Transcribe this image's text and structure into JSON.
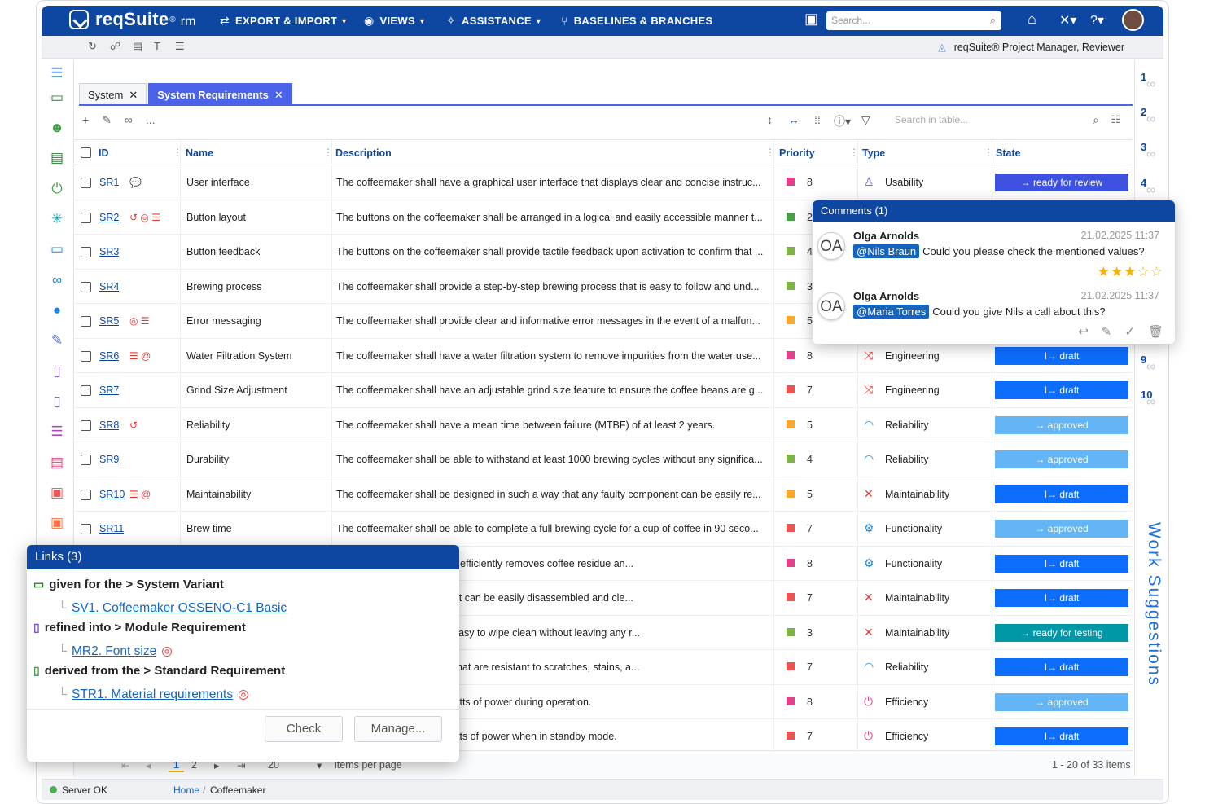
{
  "app": {
    "brand": "reqSuite",
    "brand_sup": "®",
    "brand_suffix": "rm",
    "nav": [
      {
        "label": "EXPORT & IMPORT",
        "icon": "export-import-icon"
      },
      {
        "label": "VIEWS",
        "icon": "eye-icon"
      },
      {
        "label": "ASSISTANCE",
        "icon": "magic-wand-icon"
      },
      {
        "label": "BASELINES & BRANCHES",
        "icon": "branch-icon"
      }
    ],
    "search_placeholder": "Search...",
    "role": "reqSuite® Project Manager, Reviewer"
  },
  "tabs": [
    {
      "label": "System",
      "active": false
    },
    {
      "label": "System Requirements",
      "active": true
    }
  ],
  "table": {
    "toolbar_more": "...",
    "search_placeholder": "Search in table...",
    "columns": [
      "ID",
      "Name",
      "Description",
      "Priority",
      "Type",
      "State"
    ],
    "rows": [
      {
        "id": "SR1",
        "icons": "💬",
        "name": "User interface",
        "desc": "The coffeemaker shall have a graphical user interface that displays clear and concise instruc...",
        "pcolor": "#e83e8c",
        "priority": "8",
        "ticon": "usability-icon",
        "tglyph": "♙",
        "tcolor": "#6a5acd",
        "type": "Usability",
        "state": "→ ready for review",
        "scolor": "#3f51e0"
      },
      {
        "id": "SR2",
        "icons": "↺ ◎ ☰",
        "name": "Button layout",
        "desc": "The buttons on the coffeemaker shall be arranged in a logical and easily accessible manner t...",
        "pcolor": "#43a047",
        "priority": "2",
        "ticon": "",
        "tglyph": "",
        "tcolor": "",
        "type": "",
        "state": "",
        "scolor": ""
      },
      {
        "id": "SR3",
        "icons": "",
        "name": "Button feedback",
        "desc": "The buttons on the coffeemaker shall provide tactile feedback upon activation to confirm that ...",
        "pcolor": "#7cb342",
        "priority": "4",
        "ticon": "",
        "tglyph": "",
        "tcolor": "",
        "type": "",
        "state": "",
        "scolor": ""
      },
      {
        "id": "SR4",
        "icons": "",
        "name": "Brewing process",
        "desc": "The coffeemaker shall provide a step-by-step brewing process that is easy to follow and und...",
        "pcolor": "#7cb342",
        "priority": "3",
        "ticon": "",
        "tglyph": "",
        "tcolor": "",
        "type": "",
        "state": "",
        "scolor": ""
      },
      {
        "id": "SR5",
        "icons": "◎ ☰",
        "name": "Error messaging",
        "desc": "The coffeemaker shall provide clear and informative error messages in the event of a malfun...",
        "pcolor": "#ffa726",
        "priority": "5",
        "ticon": "",
        "tglyph": "",
        "tcolor": "",
        "type": "",
        "state": "",
        "scolor": ""
      },
      {
        "id": "SR6",
        "icons": "☰ @",
        "name": "Water Filtration System",
        "desc": "The coffeemaker shall have a water filtration system to remove impurities from the water use...",
        "pcolor": "#e83e8c",
        "priority": "8",
        "ticon": "shuffle-icon",
        "tglyph": "⤨",
        "tcolor": "#e53935",
        "type": "Engineering",
        "state": "I→ draft",
        "scolor": "#0d6efd"
      },
      {
        "id": "SR7",
        "icons": "",
        "name": "Grind Size Adjustment",
        "desc": "The coffeemaker shall have an adjustable grind size feature to ensure the coffee beans are g...",
        "pcolor": "#ef5350",
        "priority": "7",
        "ticon": "shuffle-icon",
        "tglyph": "⤨",
        "tcolor": "#e53935",
        "type": "Engineering",
        "state": "I→ draft",
        "scolor": "#0d6efd"
      },
      {
        "id": "SR8",
        "icons": "↺",
        "name": "Reliability",
        "desc": "The coffeemaker shall have a mean time between failure (MTBF) of at least 2 years.",
        "pcolor": "#ffa726",
        "priority": "5",
        "ticon": "wifi-icon",
        "tglyph": "◠",
        "tcolor": "#1e88e5",
        "type": "Reliability",
        "state": "→ approved",
        "scolor": "#64b5f6"
      },
      {
        "id": "SR9",
        "icons": "",
        "name": "Durability",
        "desc": "The coffeemaker shall be able to withstand at least 1000 brewing cycles without any significa...",
        "pcolor": "#7cb342",
        "priority": "4",
        "ticon": "wifi-icon",
        "tglyph": "◠",
        "tcolor": "#1e88e5",
        "type": "Reliability",
        "state": "→ approved",
        "scolor": "#64b5f6"
      },
      {
        "id": "SR10",
        "icons": "☰ @",
        "name": "Maintainability",
        "desc": "The coffeemaker shall be designed in such a way that any faulty component can be easily re...",
        "pcolor": "#ffa726",
        "priority": "5",
        "ticon": "tools-icon",
        "tglyph": "✕",
        "tcolor": "#e53935",
        "type": "Maintainability",
        "state": "I→ draft",
        "scolor": "#0d6efd"
      },
      {
        "id": "SR11",
        "icons": "",
        "name": "Brew time",
        "desc": "The coffeemaker shall be able to complete a full brewing cycle for a cup of coffee in 90 seco...",
        "pcolor": "#ef5350",
        "priority": "7",
        "ticon": "gears-icon",
        "tglyph": "⚙",
        "tcolor": "#1e88e5",
        "type": "Functionality",
        "state": "→ approved",
        "scolor": "#64b5f6"
      },
      {
        "id": "",
        "icons": "",
        "name": "",
        "desc": "a cleaning mechanism that efficiently removes coffee residue an...",
        "pcolor": "#e83e8c",
        "priority": "8",
        "ticon": "gears-icon",
        "tglyph": "⚙",
        "tcolor": "#1e88e5",
        "type": "Functionality",
        "state": "I→ draft",
        "scolor": "#0d6efd"
      },
      {
        "id": "",
        "icons": "",
        "name": "",
        "desc": "removable components that can be easily disassembled and cle...",
        "pcolor": "#ef5350",
        "priority": "7",
        "ticon": "tools-icon",
        "tglyph": "✕",
        "tcolor": "#e53935",
        "type": "Maintainability",
        "state": "I→ draft",
        "scolor": "#0d6efd"
      },
      {
        "id": "",
        "icons": "",
        "name": "",
        "desc": "aker shall be smooth and easy to wipe clean without leaving any r...",
        "pcolor": "#7cb342",
        "priority": "3",
        "ticon": "tools-icon",
        "tglyph": "✕",
        "tcolor": "#e53935",
        "type": "Maintainability",
        "state": "→ ready for testing",
        "scolor": "#0097a7"
      },
      {
        "id": "",
        "icons": "",
        "name": "",
        "desc": "nade of durable materials that are resistant to scratches, stains, a...",
        "pcolor": "#ef5350",
        "priority": "7",
        "ticon": "wifi-icon",
        "tglyph": "◠",
        "tcolor": "#1e88e5",
        "type": "Reliability",
        "state": "I→ draft",
        "scolor": "#0d6efd"
      },
      {
        "id": "",
        "icons": "",
        "name": "",
        "desc": "sume no more than 500 watts of power during operation.",
        "pcolor": "#e83e8c",
        "priority": "8",
        "ticon": "power-icon",
        "tglyph": "⏻",
        "tcolor": "#e83e8c",
        "type": "Efficiency",
        "state": "→ approved",
        "scolor": "#64b5f6"
      },
      {
        "id": "",
        "icons": "",
        "name": "",
        "desc": "sume no more than 0.5 watts of power when in standby mode.",
        "pcolor": "#ef5350",
        "priority": "7",
        "ticon": "power-icon",
        "tglyph": "⏻",
        "tcolor": "#e83e8c",
        "type": "Efficiency",
        "state": "I→ draft",
        "scolor": "#0d6efd"
      }
    ]
  },
  "pager": {
    "pages": [
      "1",
      "2"
    ],
    "page_size": "20",
    "items_per_page": "items per page",
    "summary": "1 - 20 of 33 items"
  },
  "right_rail": {
    "numbers": [
      "1",
      "2",
      "3",
      "4",
      "9",
      "10"
    ],
    "work_suggestions": "Work Suggestions"
  },
  "footer": {
    "server": "Server OK",
    "crumb_home": "Home",
    "crumb_sep": "/",
    "crumb_current": "Coffeemaker"
  },
  "comments": {
    "title": "Comments (1)",
    "items": [
      {
        "initials": "OA",
        "author": "Olga Arnolds",
        "date": "21.02.2025 11:37",
        "mention": "@Nils Braun",
        "text": "Could you please check the mentioned values?",
        "stars": "★★★☆☆",
        "rating": 3
      },
      {
        "initials": "OA",
        "author": "Olga Arnolds",
        "date": "21.02.2025 11:37",
        "mention": "@Maria Torres",
        "text": "Could you give Nils a call about this?"
      }
    ]
  },
  "links": {
    "title": "Links (3)",
    "groups": [
      {
        "relation": "given for the > System Variant",
        "item": "SV1. Coffeemaker OSSENO-C1 Basic"
      },
      {
        "relation": "refined into > Module Requirement",
        "item": "MR2. Font size"
      },
      {
        "relation": "derived from the > Standard Requirement",
        "item": "STR1. Material requirements"
      }
    ],
    "check_label": "Check",
    "manage_label": "Manage..."
  }
}
